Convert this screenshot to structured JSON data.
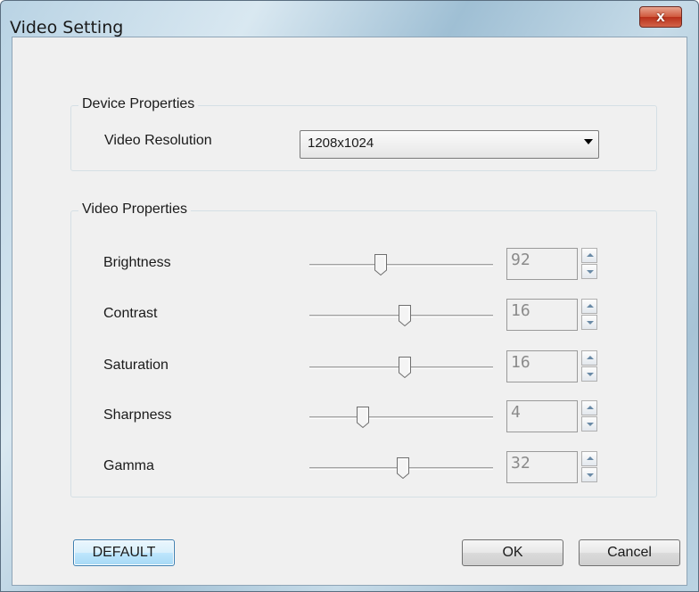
{
  "window": {
    "title": "Video Setting",
    "close_label": "x"
  },
  "device_properties": {
    "group_label": "Device Properties",
    "resolution_label": "Video Resolution",
    "resolution_value": "1208x1024"
  },
  "video_properties": {
    "group_label": "Video Properties",
    "sliders": [
      {
        "label": "Brightness",
        "value": "92",
        "level": 0.39
      },
      {
        "label": "Contrast",
        "value": "16",
        "level": 0.52
      },
      {
        "label": "Saturation",
        "value": "16",
        "level": 0.52
      },
      {
        "label": "Sharpness",
        "value": "4",
        "level": 0.29
      },
      {
        "label": "Gamma",
        "value": "32",
        "level": 0.51
      }
    ]
  },
  "buttons": {
    "default": "DEFAULT",
    "ok": "OK",
    "cancel": "Cancel"
  },
  "icons": {
    "close": "close-icon",
    "dropdown": "chevron-down-icon",
    "spin_up": "arrow-up-icon",
    "spin_down": "arrow-down-icon"
  }
}
